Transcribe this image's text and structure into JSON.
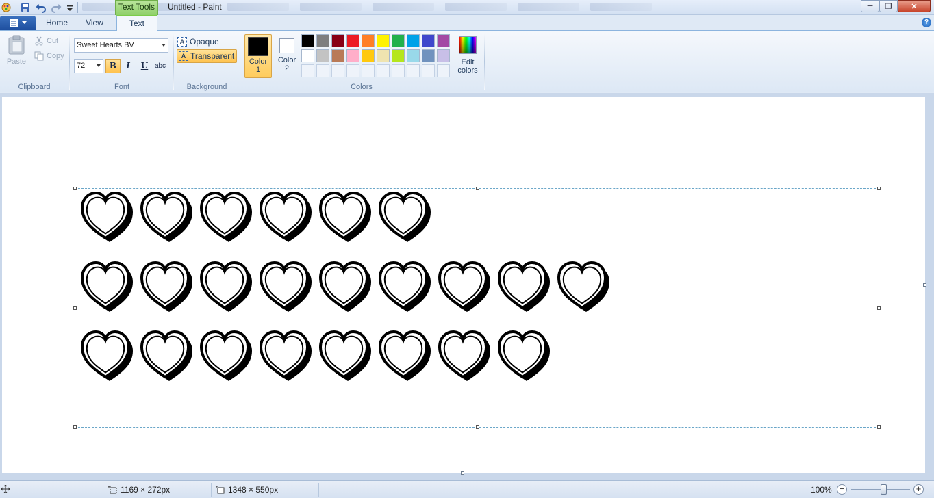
{
  "window": {
    "title": "Untitled - Paint",
    "context_tab_label": "Text Tools"
  },
  "ribbon_tabs": {
    "home": "Home",
    "view": "View",
    "text": "Text"
  },
  "clipboard": {
    "paste": "Paste",
    "cut": "Cut",
    "copy": "Copy",
    "group_label": "Clipboard"
  },
  "font": {
    "family": "Sweet Hearts BV",
    "size": "72",
    "bold": "B",
    "italic": "I",
    "underline": "U",
    "strikethrough": "abc",
    "group_label": "Font"
  },
  "background": {
    "opaque": "Opaque",
    "transparent": "Transparent",
    "icon_letter": "A",
    "group_label": "Background"
  },
  "colors": {
    "color1_line1": "Color",
    "color1_line2": "1",
    "color2_line1": "Color",
    "color2_line2": "2",
    "edit_line1": "Edit",
    "edit_line2": "colors",
    "group_label": "Colors",
    "color1": "#000000",
    "color2": "#ffffff",
    "palette_row1": [
      "#000000",
      "#7f7f7f",
      "#880015",
      "#ed1c24",
      "#ff7f27",
      "#fff200",
      "#22b14c",
      "#00a2e8",
      "#3f48cc",
      "#a349a4"
    ],
    "palette_row2": [
      "#ffffff",
      "#c3c3c3",
      "#b97a57",
      "#ffaec9",
      "#ffc90e",
      "#efe4b0",
      "#b5e61d",
      "#99d9ea",
      "#7092be",
      "#c8bfe7"
    ]
  },
  "canvas_text": {
    "line1": [
      "L",
      "I",
      "T",
      "T",
      "L",
      "E"
    ],
    "line2": [
      "P",
      "O",
      "R",
      "C",
      "E",
      "L",
      "A",
      "I",
      "N"
    ],
    "line3": [
      "P",
      "R",
      "I",
      "N",
      "C",
      "E",
      "S",
      "S"
    ]
  },
  "status": {
    "selection_size": "1169 × 272px",
    "canvas_size": "1348 × 550px",
    "zoom": "100%"
  }
}
